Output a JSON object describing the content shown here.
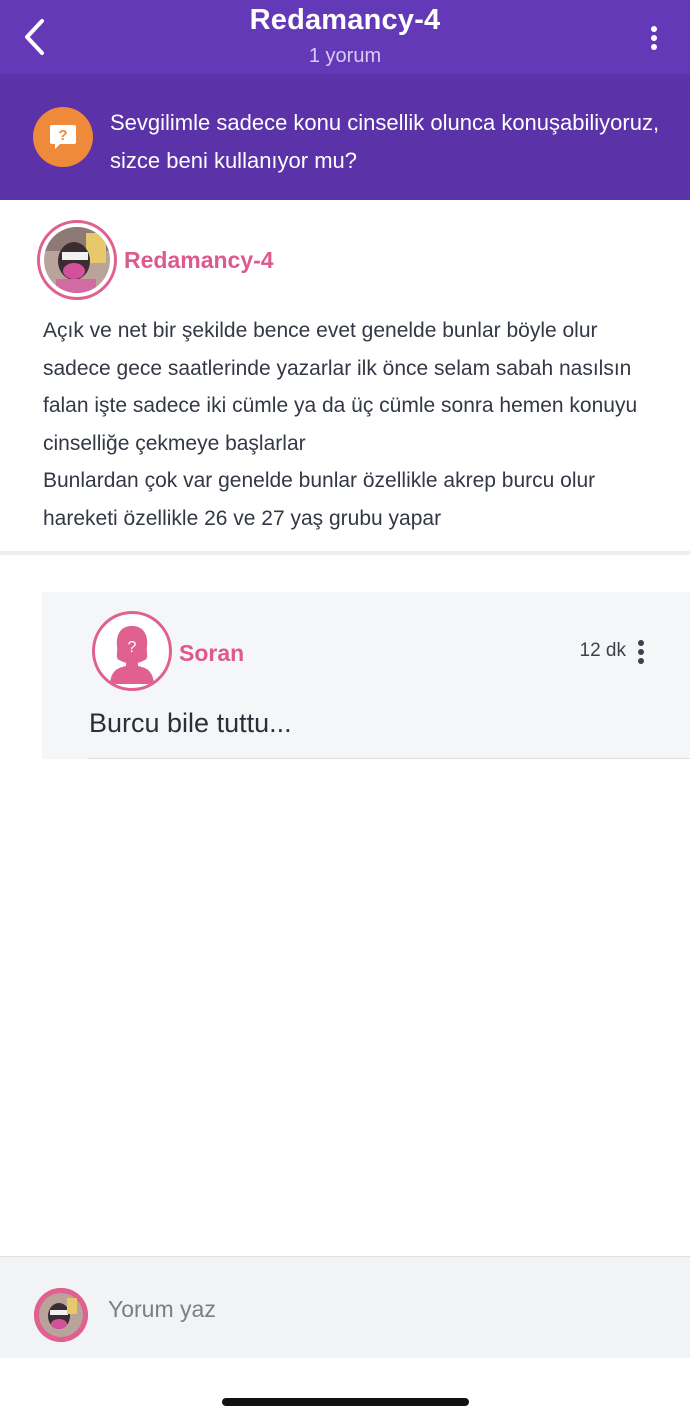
{
  "header": {
    "title": "Redamancy-4",
    "subtitle": "1 yorum",
    "back_icon": "chevron-left-icon",
    "menu_icon": "more-vertical-icon",
    "background": "#6439b8"
  },
  "question": {
    "icon": "question-bubble-icon",
    "text": "Sevgilimle sadece konu cinsellik olunca konuşabiliyoruz, sizce beni kullanıyor mu?",
    "background": "#5b32a8",
    "badge_color": "#ee8a3a"
  },
  "answer": {
    "author": "Redamancy-4",
    "text": "Açık ve net bir şekilde bence evet genelde bunlar böyle olur sadece gece saatlerinde yazarlar ilk önce selam sabah nasılsın falan işte sadece iki cümle ya da üç cümle sonra hemen konuyu cinselliğe çekmeye başlarlar\nBunlardan çok var genelde bunlar özellikle akrep burcu olur hareketi özellikle 26 ve 27 yaş grubu yapar",
    "accent": "#dc5a8c"
  },
  "comment": {
    "author": "Soran",
    "avatar_icon": "anonymous-female-icon",
    "time": "12 dk",
    "text": "Burcu bile tuttu...",
    "menu_icon": "more-vertical-icon"
  },
  "composer": {
    "placeholder": "Yorum yaz",
    "avatar_icon": "user-avatar-icon"
  }
}
